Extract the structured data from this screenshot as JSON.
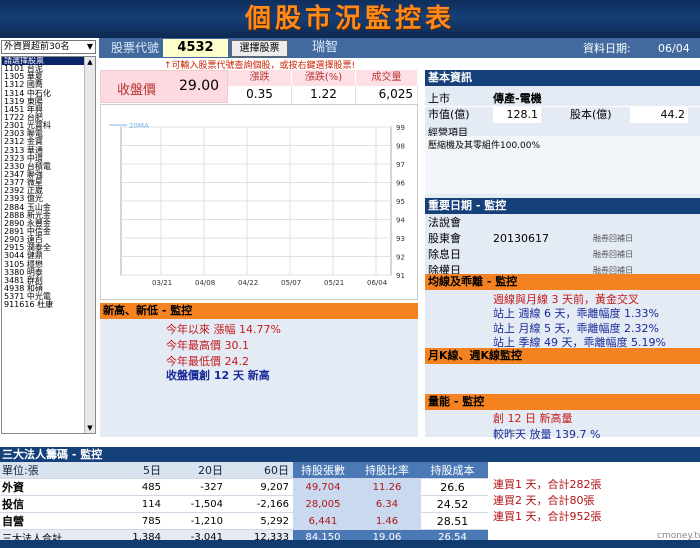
{
  "banner": {
    "title": "個股市況監控表"
  },
  "left": {
    "select_label": "外資買超前30名",
    "stocks": [
      "請選擇股票",
      "1101 台泥",
      "1305 華夏",
      "1312 國喬",
      "1314 中石化",
      "1319 東陽",
      "1451 年興",
      "1722 台肥",
      "2301 光寶科",
      "2303 聯電",
      "2312 金寶",
      "2313 華通",
      "2323 中環",
      "2330 台積電",
      "2347 聯強",
      "2377 微星",
      "2392 正崴",
      "2393 億光",
      "2884 玉山金",
      "2888 新光金",
      "2890 永豐金",
      "2891 中信金",
      "2903 遠百",
      "2915 潤泰全",
      "3044 健鼎",
      "3105 穩懋",
      "3380 明泰",
      "3481 群創",
      "4938 和碩",
      "5371 中光電",
      "911616 杜康"
    ]
  },
  "topbar": {
    "code_label": "股票代號",
    "code": "4532",
    "select_button": "選擇股票",
    "stock_name": "瑞智",
    "date_label": "資料日期:",
    "date": "06/04",
    "hint": "↑可輸入股票代號查詢個股，或按右鍵選擇股票!"
  },
  "price": {
    "close_label": "收盤價",
    "close": "29.00",
    "change_label": "漲跌",
    "change": "0.35",
    "pct_label": "漲跌(%)",
    "pct": "1.22",
    "volume_label": "成交量",
    "volume": "6,025"
  },
  "chart_data": {
    "type": "line",
    "title": "",
    "series": [
      {
        "name": "20MA",
        "values": []
      }
    ],
    "x_ticks": [
      "03/21",
      "04/08",
      "04/22",
      "05/07",
      "05/21",
      "06/04"
    ],
    "y_ticks": [
      "99",
      "98",
      "97",
      "96",
      "95",
      "94",
      "93",
      "92",
      "91"
    ],
    "ylim": [
      91,
      99
    ],
    "grid": true,
    "legend": "top-left"
  },
  "highlow": {
    "title": "新高、新低 - 監控",
    "lines": [
      "今年以來 漲幅 14.77%",
      "今年最高價 30.1",
      "今年最低價 24.2",
      "收盤價創 12 天 新高"
    ]
  },
  "basic": {
    "title": "基本資訊",
    "market_label": "上市",
    "industry": "傳產-電機",
    "mktcap_label": "市值(億)",
    "mktcap": "128.1",
    "capital_label": "股本(億)",
    "capital": "44.2",
    "biz_label": "經營項目",
    "biz_text": "壓縮機及其零組件100.00%"
  },
  "dates": {
    "title": "重要日期 - 監控",
    "rows": [
      {
        "label": "法說會",
        "value": "",
        "tag": ""
      },
      {
        "label": "股東會",
        "value": "20130617",
        "tag": "融券回補日"
      },
      {
        "label": "除息日",
        "value": "",
        "tag": "融券回補日"
      },
      {
        "label": "除權日",
        "value": "",
        "tag": "融券回補日"
      }
    ]
  },
  "ma": {
    "title": "均線及乖離 - 監控",
    "lines": [
      "週線與月線 3 天前，黃金交叉",
      "站上 週線 6 天，乖離幅度 1.33%",
      "站上 月線 5 天，乖離幅度 2.32%",
      "站上 季線 49 天，乖離幅度 5.19%"
    ]
  },
  "kline": {
    "title": "月K線、週K線監控"
  },
  "volmon": {
    "title": "量能 - 監控",
    "lines": [
      "創 12 日 新高量",
      "較昨天 放量 139.7 %"
    ]
  },
  "institutions": {
    "title": "三大法人籌碼 - 監控",
    "unit_label": "單位:張",
    "headers": [
      "5日",
      "20日",
      "60日",
      "持股張數",
      "持股比率",
      "持股成本"
    ],
    "rows": [
      {
        "name": "外資",
        "d5": "485",
        "d20": "-327",
        "d60": "9,207",
        "shares": "49,704",
        "ratio": "11.26",
        "cost": "26.6"
      },
      {
        "name": "投信",
        "d5": "114",
        "d20": "-1,504",
        "d60": "-2,166",
        "shares": "28,005",
        "ratio": "6.34",
        "cost": "24.52"
      },
      {
        "name": "自營",
        "d5": "785",
        "d20": "-1,210",
        "d60": "5,292",
        "shares": "6,441",
        "ratio": "1.46",
        "cost": "28.51"
      }
    ],
    "total": {
      "name": "三大法人合計",
      "d5": "1,384",
      "d20": "-3,041",
      "d60": "12,333",
      "shares": "84,150",
      "ratio": "19.06",
      "cost": "26.54"
    },
    "notes": [
      "連買1 天，合計282張",
      "連買2 天，合計80張",
      "連買1 天，合計952張"
    ]
  },
  "brand": "cmoney.tw"
}
